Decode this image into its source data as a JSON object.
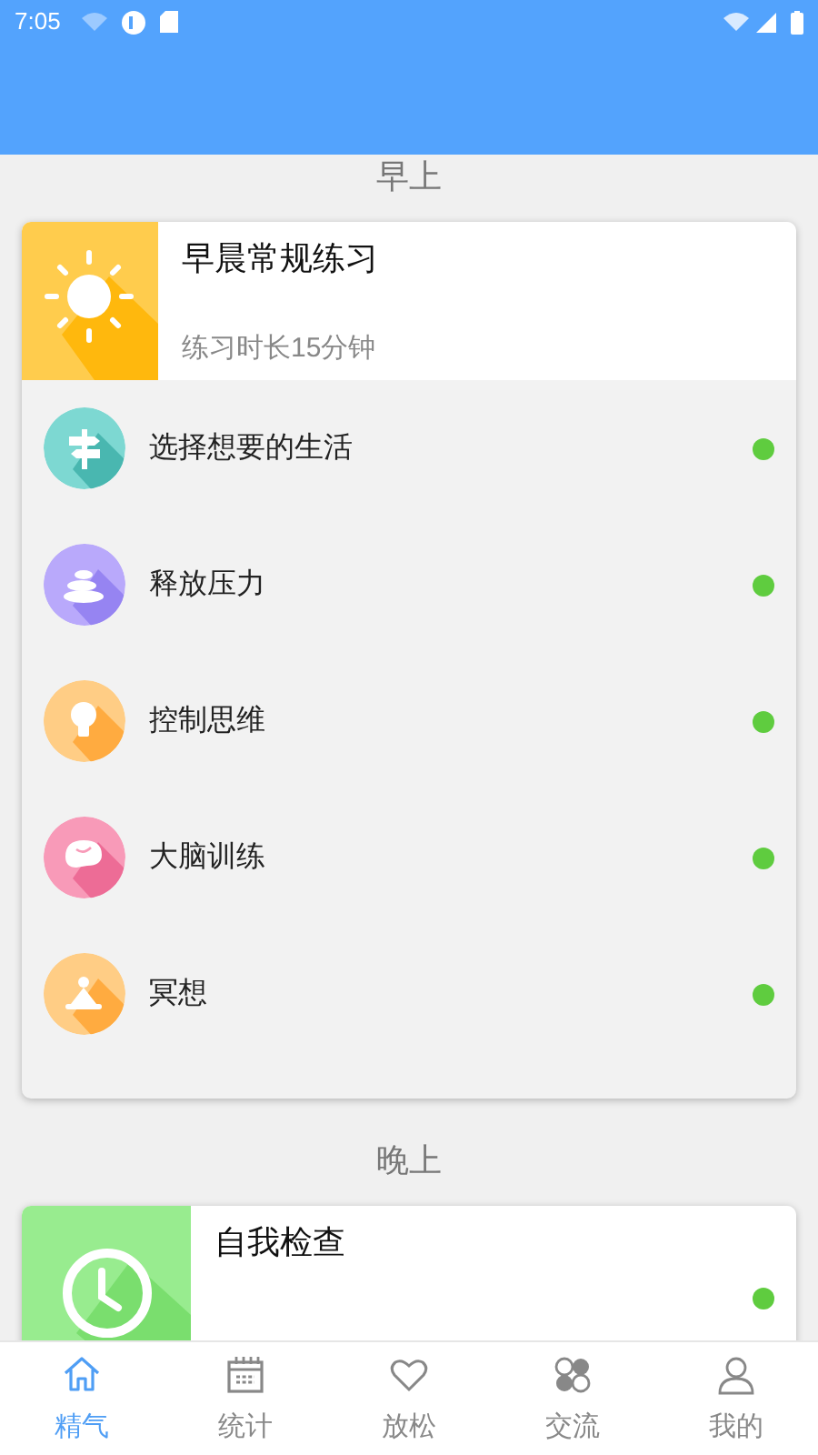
{
  "status_bar": {
    "time": "7:05"
  },
  "sections": [
    {
      "label": "早上",
      "card": {
        "kind": "sun",
        "title": "早晨常规练习",
        "subtitle": "练习时长15分钟",
        "items": [
          {
            "kind": "signpost",
            "label": "选择想要的生活",
            "completed": true
          },
          {
            "kind": "stones",
            "label": "释放压力",
            "completed": true
          },
          {
            "kind": "bulb",
            "label": "控制思维",
            "completed": true
          },
          {
            "kind": "brain",
            "label": "大脑训练",
            "completed": true
          },
          {
            "kind": "meditation",
            "label": "冥想",
            "completed": true
          }
        ]
      }
    },
    {
      "label": "晚上",
      "card": {
        "kind": "clock",
        "title": "自我检查",
        "completed": true
      }
    }
  ],
  "tabs": [
    {
      "kind": "home",
      "label": "精气",
      "selected": true
    },
    {
      "kind": "calendar",
      "label": "统计",
      "selected": false
    },
    {
      "kind": "heart",
      "label": "放松",
      "selected": false
    },
    {
      "kind": "clover",
      "label": "交流",
      "selected": false
    },
    {
      "kind": "person",
      "label": "我的",
      "selected": false
    }
  ]
}
